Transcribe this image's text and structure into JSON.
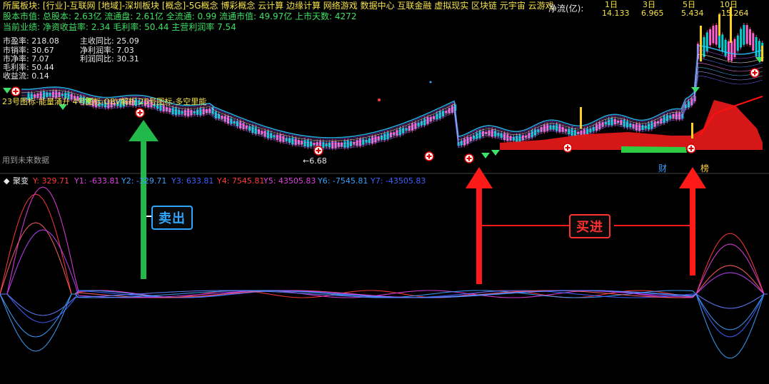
{
  "header": {
    "line1": "所属板块: [行业]-互联网 [地域]-深圳板块 [概念]-5G概念 博彩概念 云计算 边缘计算 网络游戏 数据中心 互联金融 虚拟现实 区块链 元宇宙 云游戏",
    "line2": "股本市值: 总股本: 2.63亿 流通盘: 2.61亿 全流通: 0.99 流通市值: 49.97亿 上市天数: 4272",
    "line3": "当前业绩: 净资收益率: 2.34 毛利率: 50.44 主营利润率 7.54"
  },
  "net_flow": {
    "label": "净流(亿):",
    "periods": [
      "1日",
      "3日",
      "5日",
      "10日"
    ],
    "values": [
      "14.133",
      "6.965",
      "5.434",
      "-15.264"
    ]
  },
  "stats_left": [
    "市盈率: 218.08",
    "市销率: 30.67",
    "市净率: 7.07",
    "毛利率: 50.44",
    "收益流: 0.14"
  ],
  "stats_right": [
    "主收同比: 25.09",
    "净利润率: 7.03",
    "利润同比: 30.31"
  ],
  "indicator_line": "23号图标-能量涌升 4号图标-OBV解析 25号图标-多空里能",
  "low_price_label": "←6.68",
  "future_data_label": "用到未来数据",
  "bottom_markers": [
    "财",
    "榜"
  ],
  "sub_panel": {
    "title": "聚变",
    "readouts": [
      {
        "text": "Y: 329.71",
        "color": "#ff3b3b"
      },
      {
        "text": "Y1: -633.81",
        "color": "#e040e0"
      },
      {
        "text": "Y2: -329.71",
        "color": "#3aa0ff"
      },
      {
        "text": "Y3: 633.81",
        "color": "#4060ff"
      },
      {
        "text": "Y4: 7545.81",
        "color": "#ff3b3b"
      },
      {
        "text": "Y5: 43505.83",
        "color": "#e040e0"
      },
      {
        "text": "Y6: -7545.81",
        "color": "#3aa0ff"
      },
      {
        "text": "Y7: -43505.83",
        "color": "#4060ff"
      }
    ]
  },
  "annotations": {
    "sell": "卖出",
    "buy": "买进"
  },
  "colors": {
    "up": "#ff3b3b",
    "down": "#00c0c0",
    "sell_arrow": "#22b84a",
    "buy_arrow": "#ff1a1a",
    "ma_cyan": "#2cc4ff",
    "fill_red": "#e01818",
    "fill_green": "#2ecc40"
  }
}
